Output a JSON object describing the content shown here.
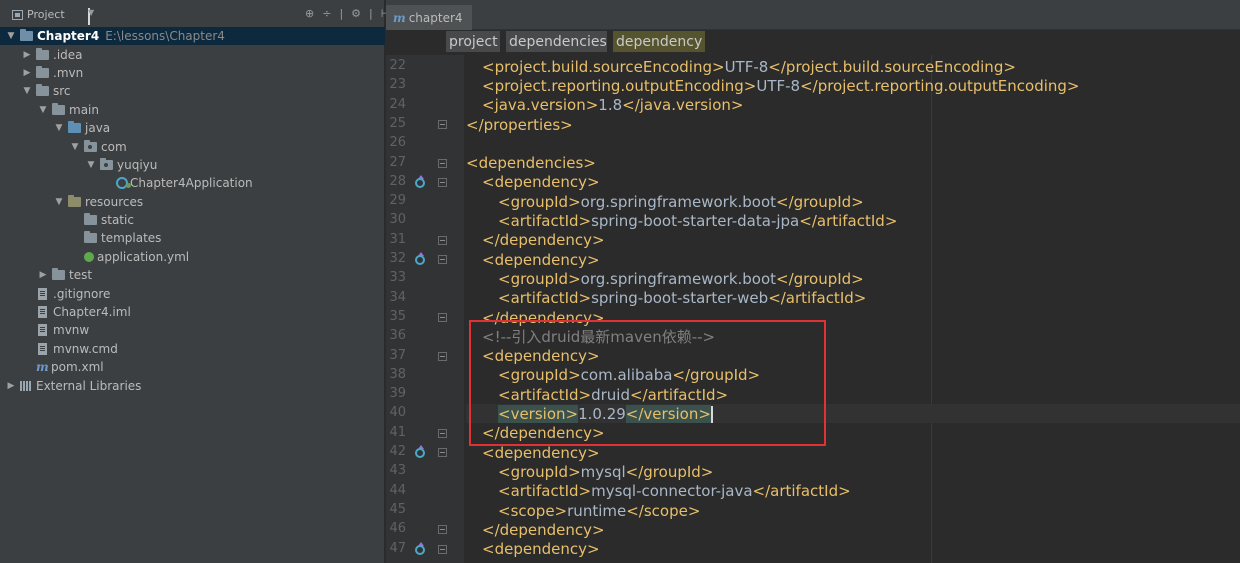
{
  "project_panel": {
    "title": "Project",
    "tools": [
      "⊕",
      "÷",
      "|",
      "⚙",
      "|",
      "⊢"
    ],
    "tree": [
      {
        "label": "Chapter4",
        "path": "E:\\lessons\\Chapter4",
        "indent": 0,
        "arrow": "▼",
        "icon": "module",
        "selected": true
      },
      {
        "label": ".idea",
        "indent": 1,
        "arrow": "▶",
        "icon": "folder"
      },
      {
        "label": ".mvn",
        "indent": 1,
        "arrow": "▶",
        "icon": "folder"
      },
      {
        "label": "src",
        "indent": 1,
        "arrow": "▼",
        "icon": "folder"
      },
      {
        "label": "main",
        "indent": 2,
        "arrow": "▼",
        "icon": "folder"
      },
      {
        "label": "java",
        "indent": 3,
        "arrow": "▼",
        "icon": "folder-blue"
      },
      {
        "label": "com",
        "indent": 4,
        "arrow": "▼",
        "icon": "pkg"
      },
      {
        "label": "yuqiyu",
        "indent": 5,
        "arrow": "▼",
        "icon": "pkg"
      },
      {
        "label": "Chapter4Application",
        "indent": 6,
        "arrow": "",
        "icon": "app"
      },
      {
        "label": "resources",
        "indent": 3,
        "arrow": "▼",
        "icon": "res"
      },
      {
        "label": "static",
        "indent": 4,
        "arrow": "",
        "icon": "folder"
      },
      {
        "label": "templates",
        "indent": 4,
        "arrow": "",
        "icon": "folder"
      },
      {
        "label": "application.yml",
        "indent": 4,
        "arrow": "",
        "icon": "yml"
      },
      {
        "label": "test",
        "indent": 2,
        "arrow": "▶",
        "icon": "folder"
      },
      {
        "label": ".gitignore",
        "indent": 1,
        "arrow": "",
        "icon": "file"
      },
      {
        "label": "Chapter4.iml",
        "indent": 1,
        "arrow": "",
        "icon": "file"
      },
      {
        "label": "mvnw",
        "indent": 1,
        "arrow": "",
        "icon": "file"
      },
      {
        "label": "mvnw.cmd",
        "indent": 1,
        "arrow": "",
        "icon": "file"
      },
      {
        "label": "pom.xml",
        "indent": 1,
        "arrow": "",
        "icon": "maven"
      },
      {
        "label": "External Libraries",
        "indent": 0,
        "arrow": "▶",
        "icon": "lib"
      }
    ]
  },
  "editor": {
    "tab": {
      "icon": "m",
      "label": "chapter4"
    },
    "breadcrumbs": [
      "project",
      "dependencies",
      "dependency"
    ],
    "lines": [
      {
        "n": "22",
        "indent": 1,
        "parts": [
          [
            "tag",
            "<project.build.sourceEncoding>"
          ],
          [
            "text",
            "UTF-8"
          ],
          [
            "tag",
            "</project.build.sourceEncoding>"
          ]
        ]
      },
      {
        "n": "23",
        "indent": 1,
        "parts": [
          [
            "tag",
            "<project.reporting.outputEncoding>"
          ],
          [
            "text",
            "UTF-8"
          ],
          [
            "tag",
            "</project.reporting.outputEncoding>"
          ]
        ]
      },
      {
        "n": "24",
        "indent": 1,
        "parts": [
          [
            "tag",
            "<java.version>"
          ],
          [
            "text",
            "1.8"
          ],
          [
            "tag",
            "</java.version>"
          ]
        ]
      },
      {
        "n": "25",
        "indent": 0,
        "fold": true,
        "parts": [
          [
            "tag",
            "</properties>"
          ]
        ]
      },
      {
        "n": "26",
        "indent": 0,
        "parts": []
      },
      {
        "n": "27",
        "indent": 0,
        "fold": true,
        "parts": [
          [
            "tag",
            "<dependencies>"
          ]
        ]
      },
      {
        "n": "28",
        "indent": 1,
        "fold": true,
        "mvn": true,
        "parts": [
          [
            "tag",
            "<dependency>"
          ]
        ]
      },
      {
        "n": "29",
        "indent": 2,
        "parts": [
          [
            "tag",
            "<groupId>"
          ],
          [
            "text",
            "org.springframework.boot"
          ],
          [
            "tag",
            "</groupId>"
          ]
        ]
      },
      {
        "n": "30",
        "indent": 2,
        "parts": [
          [
            "tag",
            "<artifactId>"
          ],
          [
            "text",
            "spring-boot-starter-data-jpa"
          ],
          [
            "tag",
            "</artifactId>"
          ]
        ]
      },
      {
        "n": "31",
        "indent": 1,
        "fold": true,
        "parts": [
          [
            "tag",
            "</dependency>"
          ]
        ]
      },
      {
        "n": "32",
        "indent": 1,
        "fold": true,
        "mvn": true,
        "parts": [
          [
            "tag",
            "<dependency>"
          ]
        ]
      },
      {
        "n": "33",
        "indent": 2,
        "parts": [
          [
            "tag",
            "<groupId>"
          ],
          [
            "text",
            "org.springframework.boot"
          ],
          [
            "tag",
            "</groupId>"
          ]
        ]
      },
      {
        "n": "34",
        "indent": 2,
        "parts": [
          [
            "tag",
            "<artifactId>"
          ],
          [
            "text",
            "spring-boot-starter-web"
          ],
          [
            "tag",
            "</artifactId>"
          ]
        ]
      },
      {
        "n": "35",
        "indent": 1,
        "fold": true,
        "parts": [
          [
            "tag",
            "</dependency>"
          ]
        ]
      },
      {
        "n": "36",
        "indent": 1,
        "parts": [
          [
            "comment",
            "<!--引入druid最新maven依赖-->"
          ]
        ]
      },
      {
        "n": "37",
        "indent": 1,
        "fold": true,
        "parts": [
          [
            "tag",
            "<dependency>"
          ]
        ]
      },
      {
        "n": "38",
        "indent": 2,
        "parts": [
          [
            "tag",
            "<groupId>"
          ],
          [
            "text",
            "com.alibaba"
          ],
          [
            "tag",
            "</groupId>"
          ]
        ]
      },
      {
        "n": "39",
        "indent": 2,
        "parts": [
          [
            "tag",
            "<artifactId>"
          ],
          [
            "text",
            "druid"
          ],
          [
            "tag",
            "</artifactId>"
          ]
        ]
      },
      {
        "n": "40",
        "indent": 2,
        "current": true,
        "parts": [
          [
            "tag-hl",
            "<version>"
          ],
          [
            "text",
            "1.0.29"
          ],
          [
            "tag-hl",
            "</version>"
          ],
          [
            "caret",
            ""
          ]
        ]
      },
      {
        "n": "41",
        "indent": 1,
        "fold": true,
        "parts": [
          [
            "tag",
            "</dependency>"
          ]
        ]
      },
      {
        "n": "42",
        "indent": 1,
        "fold": true,
        "mvn": true,
        "parts": [
          [
            "tag",
            "<dependency>"
          ]
        ]
      },
      {
        "n": "43",
        "indent": 2,
        "parts": [
          [
            "tag",
            "<groupId>"
          ],
          [
            "text",
            "mysql"
          ],
          [
            "tag",
            "</groupId>"
          ]
        ]
      },
      {
        "n": "44",
        "indent": 2,
        "parts": [
          [
            "tag",
            "<artifactId>"
          ],
          [
            "text",
            "mysql-connector-java"
          ],
          [
            "tag",
            "</artifactId>"
          ]
        ]
      },
      {
        "n": "45",
        "indent": 2,
        "parts": [
          [
            "tag",
            "<scope>"
          ],
          [
            "text",
            "runtime"
          ],
          [
            "tag",
            "</scope>"
          ]
        ]
      },
      {
        "n": "46",
        "indent": 1,
        "fold": true,
        "parts": [
          [
            "tag",
            "</dependency>"
          ]
        ]
      },
      {
        "n": "47",
        "indent": 1,
        "fold": true,
        "mvn": true,
        "parts": [
          [
            "tag",
            "<dependency>"
          ]
        ]
      }
    ]
  },
  "colors": {
    "tag": "#e8bf6a",
    "text": "#a9b7c6",
    "comment": "#808080",
    "annotation_box": "#e03234"
  }
}
